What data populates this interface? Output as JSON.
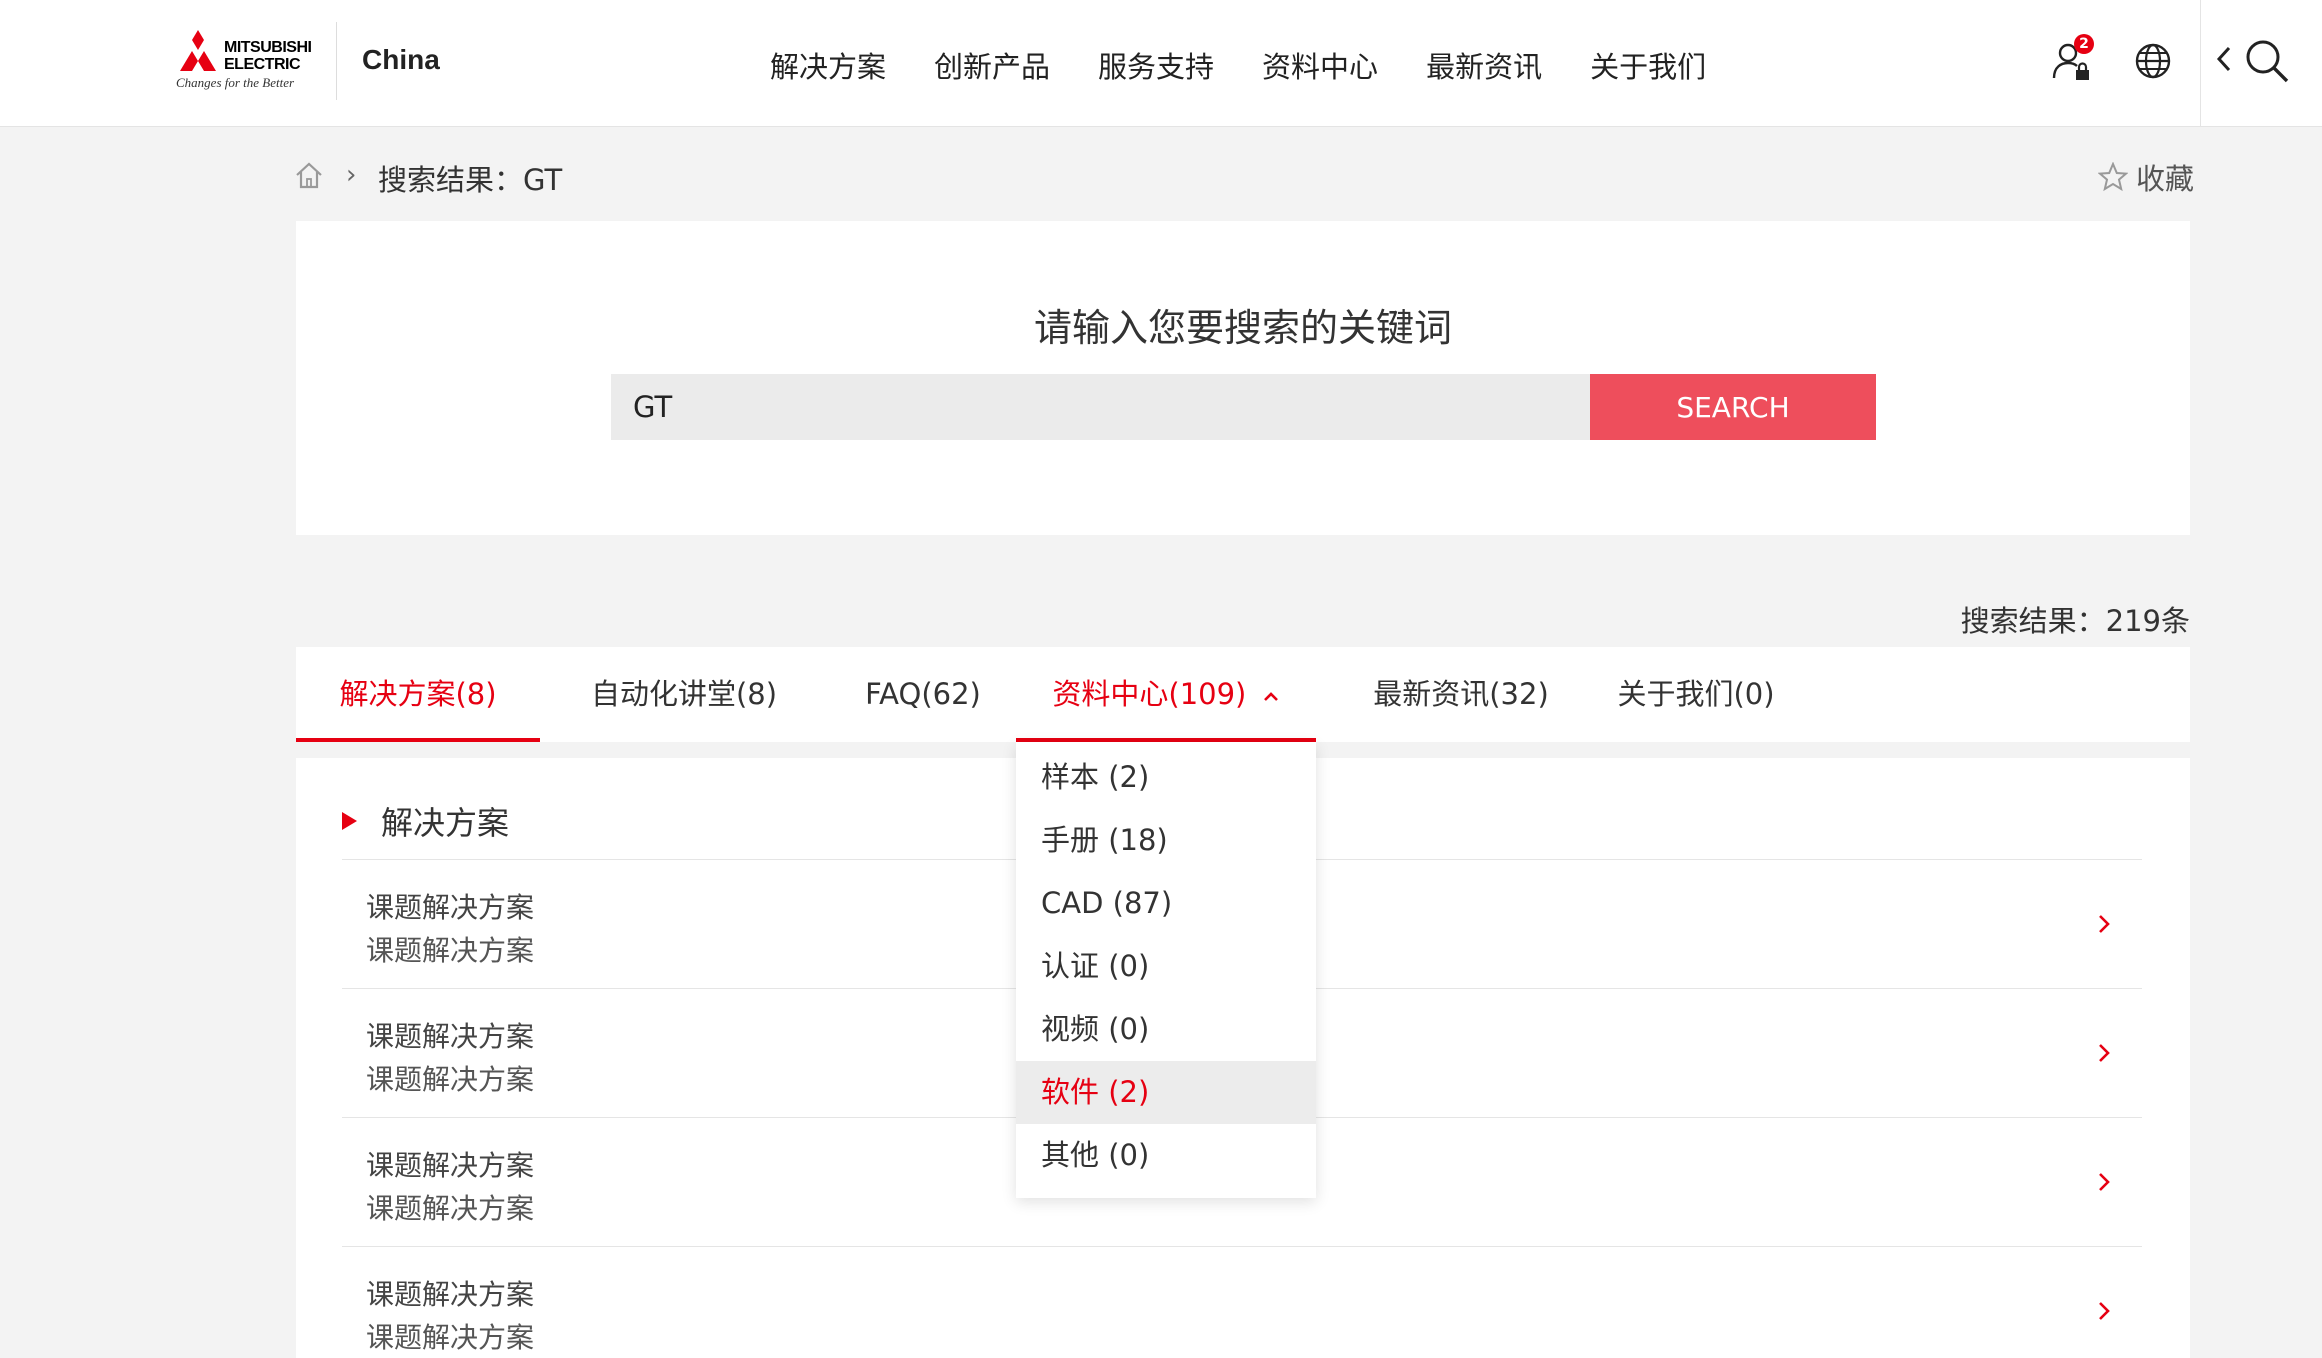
{
  "header": {
    "brand_line1": "MITSUBISHI",
    "brand_line2": "ELECTRIC",
    "tagline": "Changes for the Better",
    "region": "China",
    "nav": [
      "解决方案",
      "创新产品",
      "服务支持",
      "资料中心",
      "最新资讯",
      "关于我们"
    ],
    "user_badge": "2",
    "icons": [
      "user-lock-icon",
      "globe-icon",
      "chevron-left-icon",
      "search-icon"
    ]
  },
  "breadcrumb": {
    "current": "搜索结果：GT",
    "favorite_label": "收藏"
  },
  "search": {
    "title": "请输入您要搜索的关键词",
    "value": "GT",
    "button_label": "SEARCH"
  },
  "result_count": "搜索结果：219条",
  "tabs": [
    {
      "label": "解决方案(8)",
      "active": true
    },
    {
      "label": "自动化讲堂(8)",
      "active": false
    },
    {
      "label": "FAQ(62)",
      "active": false
    },
    {
      "label": "资料中心(109)",
      "active": false,
      "expanded": true
    },
    {
      "label": "最新资讯(32)",
      "active": false
    },
    {
      "label": "关于我们(0)",
      "active": false
    }
  ],
  "dropdown": {
    "items": [
      "样本 (2)",
      "手册 (18)",
      "CAD (87)",
      "认证 (0)",
      "视频 (0)",
      "软件 (2)",
      "其他 (0)"
    ],
    "hovered": "软件 (2)"
  },
  "results": {
    "section_title": "解决方案",
    "rows": [
      {
        "title": "课题解决方案",
        "subtitle": "课题解决方案"
      },
      {
        "title": "课题解决方案",
        "subtitle": "课题解决方案"
      },
      {
        "title": "课题解决方案",
        "subtitle": "课题解决方案"
      },
      {
        "title": "课题解决方案",
        "subtitle": "课题解决方案"
      }
    ]
  },
  "colors": {
    "accent": "#e60012",
    "search_button": "#ee4e5c",
    "page_bg": "#f3f3f3"
  }
}
